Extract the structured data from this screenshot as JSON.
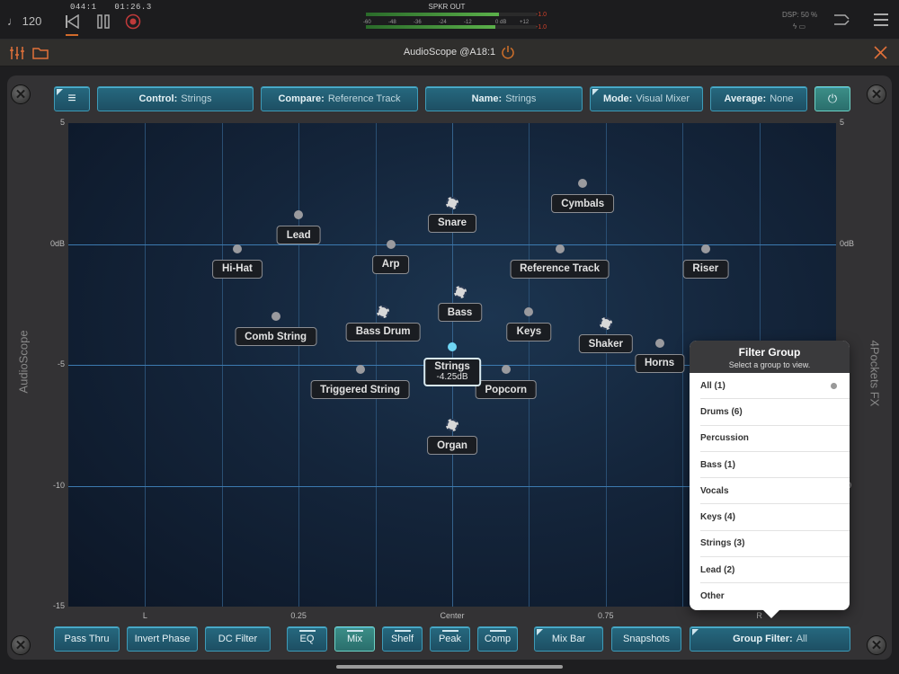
{
  "transport": {
    "tempo": "♩ 120",
    "bar_beat": "044:1",
    "time": "01:26.3"
  },
  "meter": {
    "label": "SPKR OUT",
    "scale": [
      "-60",
      "-48",
      "-36",
      "-24",
      "-12",
      "0 dB",
      "+12"
    ],
    "peak_top": "-1.0",
    "peak_bottom": "-1.0",
    "level_top": 0.78,
    "level_bottom": 0.76
  },
  "dsp": {
    "label": "DSP: 50 %",
    "battery": "ϟ ▭"
  },
  "plugin": {
    "title": "AudioScope @A18:1"
  },
  "side_left": "AudioScope",
  "side_right": "4Pockets FX",
  "top_buttons": {
    "menu_icon": "≡",
    "control": {
      "label": "Control:",
      "value": "Strings"
    },
    "compare": {
      "label": "Compare:",
      "value": "Reference Track"
    },
    "name": {
      "label": "Name:",
      "value": "Strings"
    },
    "mode": {
      "label": "Mode:",
      "value": "Visual Mixer"
    },
    "average": {
      "label": "Average:",
      "value": "None"
    },
    "power_icon": "⏻"
  },
  "plot": {
    "y_ticks_left": [
      "5",
      "0dB",
      "-5",
      "-10",
      "-15"
    ],
    "y_ticks_right": [
      "5",
      "0dB",
      "-5",
      "-10",
      "5"
    ],
    "x_ticks": [
      "L",
      "0.25",
      "Center",
      "0.75",
      "R"
    ],
    "y_range": [
      -15,
      5
    ],
    "x_range": [
      0,
      1
    ]
  },
  "instruments": [
    {
      "name": "Cymbals",
      "pan": 0.67,
      "db": 2.5,
      "dot": "normal"
    },
    {
      "name": "Snare",
      "pan": 0.5,
      "db": 1.7,
      "dot": "dashed"
    },
    {
      "name": "Lead",
      "pan": 0.3,
      "db": 1.2,
      "dot": "normal"
    },
    {
      "name": "Hi-Hat",
      "pan": 0.22,
      "db": -0.2,
      "dot": "normal"
    },
    {
      "name": "Arp",
      "pan": 0.42,
      "db": 0.0,
      "dot": "normal"
    },
    {
      "name": "Reference Track",
      "pan": 0.64,
      "db": -0.2,
      "dot": "normal"
    },
    {
      "name": "Riser",
      "pan": 0.83,
      "db": -0.2,
      "dot": "normal"
    },
    {
      "name": "Bass",
      "pan": 0.51,
      "db": -2.0,
      "dot": "dashed"
    },
    {
      "name": "Comb String",
      "pan": 0.27,
      "db": -3.0,
      "dot": "normal"
    },
    {
      "name": "Bass Drum",
      "pan": 0.41,
      "db": -2.8,
      "dot": "dashed"
    },
    {
      "name": "Keys",
      "pan": 0.6,
      "db": -2.8,
      "dot": "normal"
    },
    {
      "name": "Shaker",
      "pan": 0.7,
      "db": -3.3,
      "dot": "dashed"
    },
    {
      "name": "Horns",
      "pan": 0.77,
      "db": -4.1,
      "dot": "normal"
    },
    {
      "name": "Triggered String",
      "pan": 0.38,
      "db": -5.2,
      "dot": "normal"
    },
    {
      "name": "Popcorn",
      "pan": 0.57,
      "db": -5.2,
      "dot": "normal"
    },
    {
      "name": "Organ",
      "pan": 0.5,
      "db": -7.5,
      "dot": "dashed"
    }
  ],
  "active": {
    "name": "Strings",
    "value": "-4.25dB",
    "pan": 0.5,
    "db": -4.25
  },
  "filter": {
    "title": "Filter Group",
    "subtitle": "Select a group to view.",
    "items": [
      "All (1)",
      "Drums (6)",
      "Percussion",
      "Bass (1)",
      "Vocals",
      "Keys (4)",
      "Strings (3)",
      "Lead (2)",
      "Other"
    ],
    "selected_index": 0
  },
  "bottom_buttons": {
    "pass_thru": "Pass Thru",
    "invert_phase": "Invert Phase",
    "dc_filter": "DC Filter",
    "eq": "EQ",
    "mix": "Mix",
    "shelf": "Shelf",
    "peak": "Peak",
    "comp": "Comp",
    "mix_bar": "Mix Bar",
    "snapshots": "Snapshots",
    "group_filter": {
      "label": "Group Filter:",
      "value": "All"
    }
  },
  "colors": {
    "accent": "#2a7088",
    "active_dot": "#6fd6f5",
    "close": "#e0703a",
    "power": "#d0702a"
  }
}
